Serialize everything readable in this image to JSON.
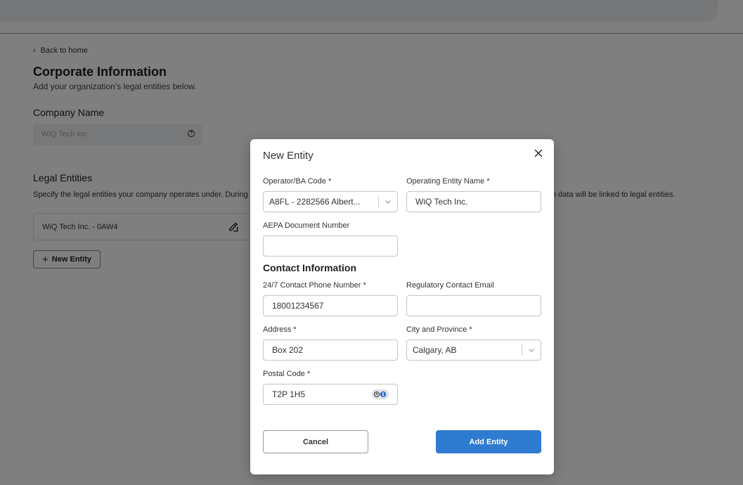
{
  "colors": {
    "accent": "#2e7bd1",
    "overlay": "rgba(0,0,0,0.5)",
    "input_border": "#c4c4c4",
    "disabled_bg": "#eef0f2"
  },
  "page": {
    "back_link": "Back to home",
    "title": "Corporate Information",
    "subtitle": "Add your organization’s legal entities below.",
    "company_name_label": "Company Name",
    "company_name_value": "WiQ Tech Inc.",
    "legal_entities_label": "Legal Entities",
    "legal_entities_sub_left": "Specify the legal entities your company operates under. During",
    "legal_entities_sub_right": "n data will be linked to legal entities.",
    "entities": [
      {
        "label": "WiQ Tech Inc. - 0AW4"
      }
    ],
    "new_entity_button": "New Entity"
  },
  "modal": {
    "title": "New Entity",
    "fields": {
      "operator_code": {
        "label": "Operator/BA Code *",
        "value": "A8FL - 2282566 Albert..."
      },
      "operating_entity_name": {
        "label": "Operating Entity Name *",
        "value": "WiQ Tech Inc."
      },
      "aepa_document_number": {
        "label": "AEPA Document Number",
        "value": ""
      },
      "contact_phone": {
        "label": "24/7 Contact Phone Number *",
        "value": "18001234567"
      },
      "regulatory_email": {
        "label": "Regulatory Contact Email",
        "value": ""
      },
      "address": {
        "label": "Address *",
        "value": "Box 202"
      },
      "city_province": {
        "label": "City and Province *",
        "value": "Calgary, AB"
      },
      "postal_code": {
        "label": "Postal Code *",
        "value": "T2P 1H5"
      }
    },
    "contact_section_title": "Contact Information",
    "cancel_button": "Cancel",
    "submit_button": "Add Entity"
  }
}
